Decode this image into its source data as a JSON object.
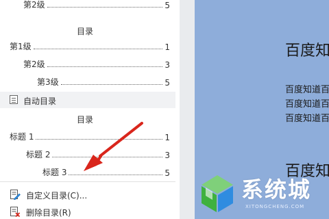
{
  "toc_partial": {
    "label": "第2级",
    "page": "5"
  },
  "toc_option_1": {
    "title": "目录",
    "entries": [
      {
        "label": "第1级",
        "page": "1"
      },
      {
        "label": "第2级",
        "page": "3"
      },
      {
        "label": "第3级",
        "page": "5"
      }
    ]
  },
  "auto_toc": {
    "section_label": "自动目录",
    "title": "目录",
    "entries": [
      {
        "label": "标题 1",
        "page": "1"
      },
      {
        "label": "标题 2",
        "page": "3"
      },
      {
        "label": "标题 3",
        "page": "5"
      }
    ]
  },
  "actions": {
    "custom_toc": "自定义目录(C)...",
    "delete_toc": "删除目录(R)"
  },
  "document": {
    "heading_1": "百度知",
    "lines": [
      "百度知道百",
      "百度知道百",
      "百度知道百"
    ],
    "heading_2": "百度知"
  },
  "watermark": {
    "text": "系统城",
    "subtext": "XITONGCHENG.COM"
  },
  "colors": {
    "doc_background": "#8eadda",
    "arrow": "#d9261c",
    "logo_green": "#3fb13f",
    "logo_blue": "#2f8ce0"
  }
}
